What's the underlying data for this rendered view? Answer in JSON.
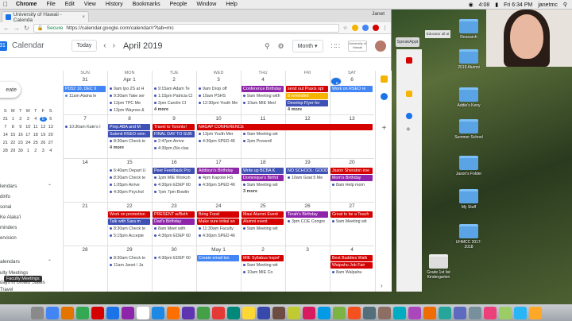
{
  "menubar": {
    "app": "Chrome",
    "items": [
      "File",
      "Edit",
      "View",
      "History",
      "Bookmarks",
      "People",
      "Window",
      "Help"
    ],
    "time": "4:08",
    "user": "Janet",
    "clock": "Fri 6:34 PM",
    "user2": "janetmc"
  },
  "browser": {
    "tab_title": "University of Hawaii - Calenda",
    "user": "Janet",
    "secure_label": "Secure",
    "url": "https://calendar.google.com/calendar/r?tab=mc"
  },
  "header": {
    "logo": "Calendar",
    "today_button": "Today",
    "month_title": "April 2019",
    "view_select": "Month",
    "org_label": "University of Hawaii"
  },
  "sidebar": {
    "create_label": "eate",
    "mini_days": [
      "S",
      "M",
      "T",
      "W",
      "T",
      "F",
      "S"
    ],
    "mini_rows": [
      [
        "31",
        "1",
        "2",
        "3",
        "4",
        "5",
        "6"
      ],
      [
        "7",
        "8",
        "9",
        "10",
        "11",
        "12",
        "13"
      ],
      [
        "14",
        "15",
        "16",
        "17",
        "18",
        "19",
        "20"
      ],
      [
        "21",
        "22",
        "23",
        "24",
        "25",
        "26",
        "27"
      ],
      [
        "28",
        "29",
        "30",
        "1",
        "2",
        "3",
        "4"
      ]
    ],
    "section_calendars": "lendars",
    "items": [
      "dinfo",
      "sonal",
      "Ke Alaka'i",
      "minders",
      "ervision"
    ],
    "section_other": "alendars",
    "other_items": [
      "ulty Meetings",
      "days in United States",
      "Travel"
    ],
    "tooltip": "Faculty Meetings"
  },
  "calendar": {
    "dows": [
      "SUN",
      "MON",
      "TUE",
      "WED",
      "THU",
      "FRI",
      "SAT"
    ],
    "weeks": [
      {
        "nums": [
          "31",
          "Apr 1",
          "2",
          "3",
          "4",
          "5",
          "6"
        ],
        "events": [
          {
            "d": 0,
            "t": "PD52 10, DEC 9",
            "fill": "#4285f4"
          },
          {
            "d": 0,
            "t": "11am Aiaina le",
            "dot": "#4285f4"
          },
          {
            "d": 1,
            "t": "9am Ipo 2S at H",
            "dot": "#3f51b5"
          },
          {
            "d": 1,
            "t": "9:30am Take ser",
            "dot": "#3f51b5"
          },
          {
            "d": 1,
            "t": "12pm TPC Me",
            "dot": "#3f51b5"
          },
          {
            "d": 1,
            "t": "12pm Waynes &",
            "dot": "#3f51b5"
          },
          {
            "d": 2,
            "t": "9:15am Adam Te",
            "dot": "#3f51b5"
          },
          {
            "d": 2,
            "t": "1:15pm Patricia Cl",
            "dot": "#3f51b5"
          },
          {
            "d": 2,
            "t": "2pm Carolin Cl",
            "dot": "#3f51b5"
          },
          {
            "d": 3,
            "t": "9am Drop off",
            "dot": "#3f51b5"
          },
          {
            "d": 3,
            "t": "10am PSHS",
            "dot": "#3f51b5"
          },
          {
            "d": 3,
            "t": "12:30pm Youth Me",
            "dot": "#3f51b5"
          },
          {
            "d": 4,
            "t": "Conference Birthday",
            "fill": "#8e24aa"
          },
          {
            "d": 4,
            "t": "9am Meeting with",
            "dot": "#3f51b5"
          },
          {
            "d": 4,
            "t": "10am MIE Med",
            "dot": "#3f51b5"
          },
          {
            "d": 5,
            "t": "send out Praxis opt",
            "fill": "#d50000"
          },
          {
            "d": 5,
            "t": "8 reminded",
            "fill": "#f4b400"
          },
          {
            "d": 5,
            "t": "Develop Flyer for",
            "fill": "#3f51b5"
          },
          {
            "d": 6,
            "t": "Work on RSEO re",
            "fill": "#4285f4"
          }
        ],
        "more": [
          {
            "d": 2,
            "t": "4 more"
          },
          {
            "d": 5,
            "t": "4 more"
          }
        ]
      },
      {
        "nums": [
          "7",
          "8",
          "9",
          "10",
          "11",
          "12",
          "13"
        ],
        "events": [
          {
            "d": 1,
            "t": "Prep ABA and M",
            "fill": "#3f51b5"
          },
          {
            "d": 1,
            "t": "Submit RSEO reim",
            "fill": "#3f51b5"
          },
          {
            "d": 1,
            "t": "8:30am Check te",
            "dot": "#3f51b5"
          },
          {
            "d": 0,
            "t": "10:30am Kate's I",
            "dot": "#3f51b5"
          },
          {
            "d": 2,
            "t": "Travel to Toronto!",
            "fill": "#d50000"
          },
          {
            "d": 2,
            "t": "FINAL DAY TO SUB",
            "fill": "#3f51b5"
          },
          {
            "d": 2,
            "t": "2:47pm Arrive",
            "dot": "#3f51b5"
          },
          {
            "d": 2,
            "t": "4:30pm (No clas",
            "dot": "#3f51b5"
          },
          {
            "d": 3,
            "t": "12pm Youth Mer",
            "dot": "#3f51b5"
          },
          {
            "d": 3,
            "t": "4:30pm SPED 46",
            "dot": "#3f51b5"
          },
          {
            "d": 4,
            "t": "9am Meeting wit",
            "dot": "#3f51b5"
          },
          {
            "d": 4,
            "t": "2pm Present!",
            "dot": "#3f51b5"
          }
        ],
        "span": {
          "from": 3,
          "to": 6,
          "t": "NAGAP CONFERENCE",
          "fill": "#d50000"
        },
        "more": [
          {
            "d": 1,
            "t": "4 more"
          }
        ]
      },
      {
        "nums": [
          "14",
          "15",
          "16",
          "17",
          "18",
          "19",
          "20"
        ],
        "events": [
          {
            "d": 1,
            "t": "6:40am Depart U",
            "dot": "#3f51b5"
          },
          {
            "d": 1,
            "t": "8:30am Check te",
            "dot": "#3f51b5"
          },
          {
            "d": 1,
            "t": "1:05pm Arrive",
            "dot": "#3f51b5"
          },
          {
            "d": 1,
            "t": "4:30pm Psychol",
            "dot": "#3f51b5"
          },
          {
            "d": 2,
            "t": "Peer Feedback Pro",
            "fill": "#3f51b5"
          },
          {
            "d": 2,
            "t": "1pm MIE Worksh",
            "dot": "#3f51b5"
          },
          {
            "d": 2,
            "t": "4:30pm EDEP 60",
            "dot": "#3f51b5"
          },
          {
            "d": 2,
            "t": "7pm 7pm Bowlin",
            "dot": "#3f51b5"
          },
          {
            "d": 3,
            "t": "Addisyn's Birthday",
            "fill": "#8e24aa"
          },
          {
            "d": 3,
            "t": "4pm Kapolei HS",
            "dot": "#3f51b5"
          },
          {
            "d": 3,
            "t": "4:30pm SPED 46",
            "dot": "#3f51b5"
          },
          {
            "d": 4,
            "t": "Write up BCBA K",
            "fill": "#3f51b5"
          },
          {
            "d": 4,
            "t": "Dominique's Birthd",
            "fill": "#8e24aa"
          },
          {
            "d": 4,
            "t": "9am Meeting wit",
            "dot": "#3f51b5"
          },
          {
            "d": 5,
            "t": "NO SCHOOL: GOOD",
            "fill": "#3f51b5"
          },
          {
            "d": 5,
            "t": "10am Goal 5 Me",
            "dot": "#3f51b5"
          },
          {
            "d": 6,
            "t": "Jason Sheraton eve",
            "fill": "#d50000"
          },
          {
            "d": 6,
            "t": "Mom's Birthday",
            "fill": "#8e24aa"
          },
          {
            "d": 6,
            "t": "8am Help mom",
            "dot": "#3f51b5"
          }
        ],
        "more": [
          {
            "d": 4,
            "t": "3 more"
          }
        ]
      },
      {
        "nums": [
          "21",
          "22",
          "23",
          "24",
          "25",
          "26",
          "27"
        ],
        "events": [
          {
            "d": 1,
            "t": "Work on promotion",
            "fill": "#d50000"
          },
          {
            "d": 1,
            "t": "Talk with Sara m",
            "fill": "#3f51b5"
          },
          {
            "d": 1,
            "t": "8:30am Check te",
            "dot": "#3f51b5"
          },
          {
            "d": 1,
            "t": "5:15pm Accepte",
            "dot": "#3f51b5"
          },
          {
            "d": 2,
            "t": "PRESENT w/Beth",
            "fill": "#d50000"
          },
          {
            "d": 2,
            "t": "Dad's Birthday",
            "fill": "#8e24aa"
          },
          {
            "d": 2,
            "t": "8am Meet with",
            "dot": "#3f51b5"
          },
          {
            "d": 2,
            "t": "4:30pm EDEP 60",
            "dot": "#3f51b5"
          },
          {
            "d": 3,
            "t": "Bring Food",
            "fill": "#d50000"
          },
          {
            "d": 3,
            "t": "Make sure initial an",
            "fill": "#d50000"
          },
          {
            "d": 3,
            "t": "11:30am Faculty",
            "dot": "#3f51b5"
          },
          {
            "d": 3,
            "t": "4:30pm SPED 46",
            "dot": "#3f51b5"
          },
          {
            "d": 4,
            "t": "Maui Alumni Event",
            "fill": "#d50000"
          },
          {
            "d": 4,
            "t": "Alumni event",
            "fill": "#d50000"
          },
          {
            "d": 4,
            "t": "9am Meeting wit",
            "dot": "#3f51b5"
          },
          {
            "d": 5,
            "t": "Terah's Birthday",
            "fill": "#8e24aa"
          },
          {
            "d": 5,
            "t": "3pm COE Congre",
            "dot": "#3f51b5"
          },
          {
            "d": 6,
            "t": "Great to be a Teach",
            "fill": "#d50000"
          },
          {
            "d": 6,
            "t": "9am Meeting wit",
            "dot": "#3f51b5"
          }
        ]
      },
      {
        "nums": [
          "28",
          "29",
          "30",
          "May 1",
          "2",
          "3",
          "4"
        ],
        "events": [
          {
            "d": 1,
            "t": "8:30am Check te",
            "dot": "#3f51b5"
          },
          {
            "d": 1,
            "t": "11am Janet / Ja",
            "dot": "#3f51b5"
          },
          {
            "d": 2,
            "t": "4:30pm EDEP 60",
            "dot": "#3f51b5"
          },
          {
            "d": 3,
            "t": "Create email tex",
            "fill": "#4285f4"
          },
          {
            "d": 4,
            "t": "MIE Syllabus hopef",
            "fill": "#d50000"
          },
          {
            "d": 4,
            "t": "9am Meeting wit",
            "dot": "#3f51b5"
          },
          {
            "d": 4,
            "t": "10am MIE Co",
            "dot": "#3f51b5"
          },
          {
            "d": 6,
            "t": "Best Buddies Walk",
            "fill": "#d50000"
          },
          {
            "d": 6,
            "t": "Waipahu Job Fair",
            "fill": "#d50000"
          },
          {
            "d": 6,
            "t": "8am Walpahu",
            "dot": "#3f51b5"
          }
        ]
      }
    ]
  },
  "desktop": {
    "speak_label": "SpeakAppt",
    "folders": [
      "Research",
      "2019 Alumni",
      "Addie's Keny",
      "Summer School",
      "Jason's Folder",
      "My Stuff",
      "UHMCC 2017-2018",
      "Grade 1st list Kindergarten"
    ],
    "screenshot_label": "Educator all at"
  },
  "colors": {
    "accent": "#1a73e8",
    "red": "#d50000",
    "purple": "#8e24aa",
    "indigo": "#3f51b5"
  }
}
